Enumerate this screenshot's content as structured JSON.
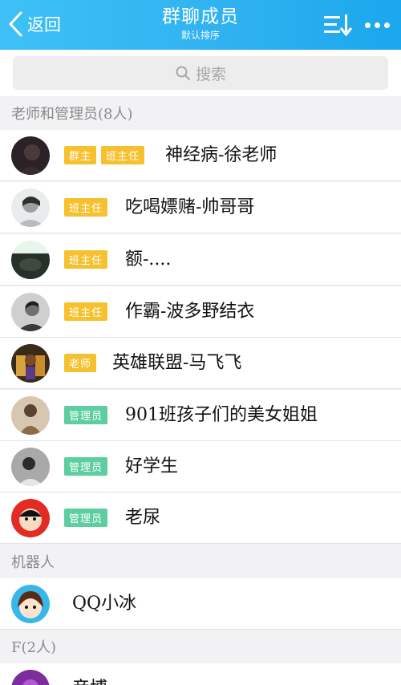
{
  "header": {
    "back_label": "返回",
    "title": "群聊成员",
    "subtitle": "默认排序",
    "background": "#2eb1ef"
  },
  "search": {
    "placeholder": "搜索"
  },
  "sections": [
    {
      "title": "老师和管理员(8人)",
      "members": [
        {
          "badges": [
            "群主",
            "班主任"
          ],
          "name": "神经病-徐老师"
        },
        {
          "badges": [
            "班主任"
          ],
          "name": "吃喝嫖赌-帅哥哥"
        },
        {
          "badges": [
            "班主任"
          ],
          "name": "额-...."
        },
        {
          "badges": [
            "班主任"
          ],
          "name": "作霸-波多野结衣"
        },
        {
          "badges": [
            "老师"
          ],
          "name": "英雄联盟-马飞飞"
        },
        {
          "badges": [
            "管理员"
          ],
          "name": "901班孩子们的美女姐姐"
        },
        {
          "badges": [
            "管理员"
          ],
          "name": "好学生"
        },
        {
          "badges": [
            "管理员"
          ],
          "name": "老尿"
        }
      ]
    },
    {
      "title": "机器人",
      "members": [
        {
          "badges": [],
          "name": "QQ小冰"
        }
      ]
    },
    {
      "title": "F(2人)",
      "members": [
        {
          "badges": [],
          "name": "帝博"
        }
      ]
    }
  ],
  "colors": {
    "badge_yellow": "#f6c12f",
    "badge_green": "#5dcea0"
  }
}
